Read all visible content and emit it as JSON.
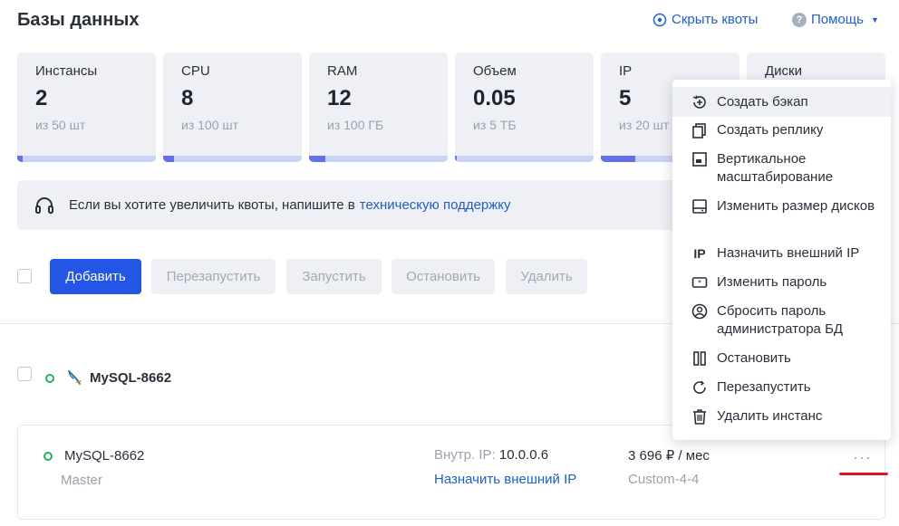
{
  "header": {
    "title": "Базы данных",
    "hide_quotas": "Скрыть квоты",
    "help": "Помощь"
  },
  "quotas": [
    {
      "name": "Инстансы",
      "value": "2",
      "limit": "из 50 шт",
      "usage": 0.04
    },
    {
      "name": "CPU",
      "value": "8",
      "limit": "из 100 шт",
      "usage": 0.08
    },
    {
      "name": "RAM",
      "value": "12",
      "limit": "из 100 ГБ",
      "usage": 0.12
    },
    {
      "name": "Объем",
      "value": "0.05",
      "limit": "из 5 ТБ",
      "usage": 0.01
    },
    {
      "name": "IP",
      "value": "5",
      "limit": "из 20 шт",
      "usage": 0.25
    },
    {
      "name": "Диски",
      "value": "",
      "limit": "",
      "usage": 0
    }
  ],
  "info": {
    "text": "Если вы хотите увеличить квоты, напишите в",
    "link": "техническую поддержку"
  },
  "toolbar": {
    "add": "Добавить",
    "restart": "Перезапустить",
    "start": "Запустить",
    "stop": "Остановить",
    "delete": "Удалить"
  },
  "group": {
    "name": "MySQL-8662"
  },
  "instance": {
    "name": "MySQL-8662",
    "role": "Master",
    "ip_label": "Внутр. IP:",
    "ip_value": "10.0.0.6",
    "assign_ip": "Назначить внешний IP",
    "price": "3 696 ₽ / мес",
    "config": "Custom-4-4",
    "more": "···"
  },
  "menu": [
    {
      "icon": "backup-icon",
      "label": "Создать бэкап"
    },
    {
      "icon": "replica-icon",
      "label": "Создать реплику"
    },
    {
      "icon": "vertical-scale-icon",
      "label": "Вертикальное масштабирование"
    },
    {
      "icon": "disk-icon",
      "label": "Изменить размер дисков"
    },
    {
      "icon": "ip-icon",
      "label": "Назначить внешний IP"
    },
    {
      "icon": "password-icon",
      "label": "Изменить пароль"
    },
    {
      "icon": "user-icon",
      "label": "Сбросить пароль администратора БД"
    },
    {
      "icon": "stop-icon",
      "label": "Остановить"
    },
    {
      "icon": "restart-icon",
      "label": "Перезапустить"
    },
    {
      "icon": "trash-icon",
      "label": "Удалить инстанс"
    }
  ],
  "colors": {
    "accent": "#2456e6",
    "link": "#1f5fc4",
    "status_ok": "#22b35e",
    "annotation": "#e0171e"
  }
}
